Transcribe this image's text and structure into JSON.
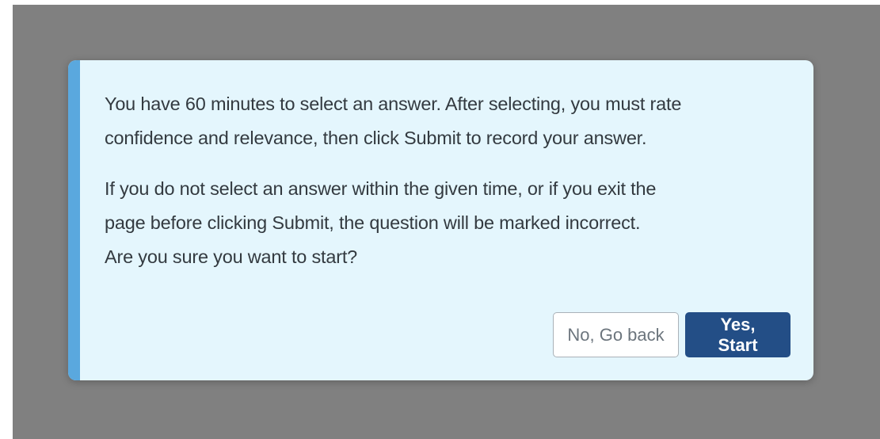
{
  "dialog": {
    "paragraph1": [
      "You have 60 minutes to select an answer. After selecting, you must rate",
      "confidence and relevance, then click Submit to record your answer."
    ],
    "paragraph2": [
      "If you do not select an answer within the given time, or if you exit the",
      "page before clicking Submit, the question will be marked incorrect.",
      "Are you sure you want to start?"
    ],
    "buttons": {
      "cancel_label": "No, Go back",
      "confirm_label": "Yes, Start"
    }
  },
  "colors": {
    "overlay": "#808080",
    "dialog_background": "#e4f6fd",
    "accent": "#5aa8de",
    "primary_button": "#234e86"
  }
}
